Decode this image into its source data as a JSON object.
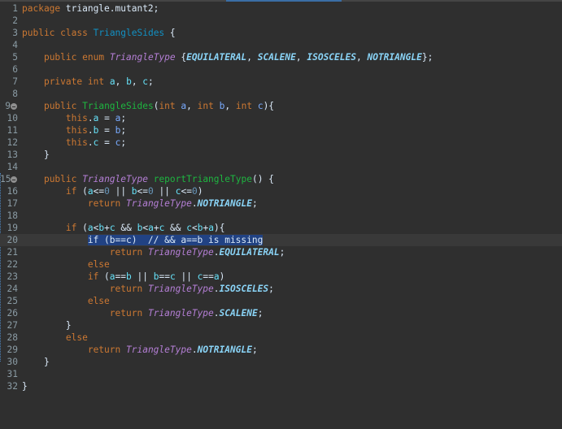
{
  "editor": {
    "package_keyword": "package",
    "package_name": " triangle.mutant2;",
    "class_name": "TriangleSides",
    "enum_name": "TriangleType",
    "enum_constants": [
      "EQUILATERAL",
      "SCALENE",
      "ISOSCELES",
      "NOTRIANGLE"
    ],
    "method_name": "reportTriangleType",
    "selected_text": "if (b==c)  // && a==b is missing",
    "current_line": 20,
    "folded_lines": [
      9,
      15
    ],
    "line_numbers": [
      "1",
      "2",
      "3",
      "4",
      "5",
      "6",
      "7",
      "8",
      "9",
      "10",
      "11",
      "12",
      "13",
      "14",
      "15",
      "16",
      "17",
      "18",
      "19",
      "20",
      "21",
      "22",
      "23",
      "24",
      "25",
      "26",
      "27",
      "28",
      "29",
      "30",
      "31",
      "32"
    ]
  },
  "colors": {
    "background": "#2f2f2f",
    "keyword": "#cc7832",
    "class": "#1290c3",
    "enum_type": "#b57fd6",
    "enum_constant": "#8ad4f7",
    "field": "#66e1f8",
    "parameter": "#79abff",
    "method": "#1eb540",
    "selection": "#214283"
  },
  "tokens": {
    "public": "public",
    "class": "class",
    "enum": "enum",
    "private": "private",
    "int": "int",
    "this": "this",
    "if": "if",
    "else": "else",
    "return": "return",
    "a": "a",
    "b": "b",
    "c": "c",
    "zero": "0"
  }
}
